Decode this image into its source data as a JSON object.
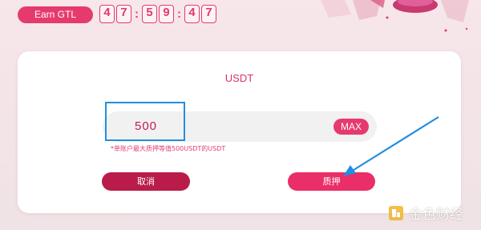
{
  "header": {
    "earn_label": "Earn GTL",
    "timer": {
      "h1": "4",
      "h2": "7",
      "m1": "5",
      "m2": "9",
      "s1": "4",
      "s2": "7",
      "sep": ":"
    }
  },
  "card": {
    "title": "USDT",
    "amount_value": "500",
    "max_label": "MAX",
    "hint": "*单账户最大质押等值500USDT的USDT",
    "cancel_label": "取消",
    "stake_label": "质押"
  },
  "watermark": {
    "text": "金色财经"
  },
  "colors": {
    "accent": "#e63a6f",
    "cancel": "#b91c49",
    "annotation": "#1f8fe0"
  },
  "icons": {
    "watermark_logo": "jinse-logo-icon",
    "deco": "isometric-illustration"
  }
}
